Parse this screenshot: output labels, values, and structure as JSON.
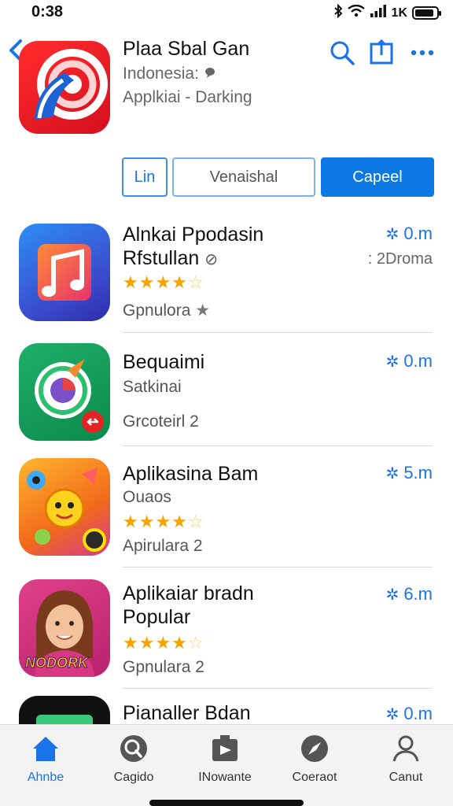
{
  "status": {
    "time": "0:38",
    "network": "1K"
  },
  "header": {
    "title": "Plaa Sbal Gan",
    "subtitle": "Indonesia:",
    "category": "Applkiai - Darking"
  },
  "actions": {
    "btn1": "Lin",
    "btn2": "Venaishal",
    "btn3": "Capeel"
  },
  "apps": [
    {
      "title": "Alnkai Ppodasin",
      "title2": "Rfstullan",
      "stars": 4,
      "meta": "Gpnulora",
      "size": "0.m",
      "right2": ": 2Droma"
    },
    {
      "title": "Bequaimi",
      "sub": "Satkinai",
      "meta": "Grcoteirl 2",
      "size": "0.m"
    },
    {
      "title": "Aplikasina Bam",
      "sub": "Ouaos",
      "stars": 4,
      "meta": "Apirulara 2",
      "size": "5.m"
    },
    {
      "title": "Aplikaiar bradn",
      "title2": "Popular",
      "stars": 4,
      "meta": "Gpnulara 2",
      "size": "6.m",
      "badge": "NODORK"
    },
    {
      "title": "Pianaller Bdan",
      "size": "0.m"
    }
  ],
  "tabs": [
    {
      "label": "Ahnbe",
      "icon": "home-icon"
    },
    {
      "label": "Cagido",
      "icon": "search-icon"
    },
    {
      "label": "INowante",
      "icon": "flag-icon"
    },
    {
      "label": "Coeraot",
      "icon": "compass-icon"
    },
    {
      "label": "Canut",
      "icon": "person-icon"
    }
  ],
  "colors": {
    "accent": "#1a73e8",
    "primary_button": "#0b78e3",
    "star": "#f5a300"
  }
}
